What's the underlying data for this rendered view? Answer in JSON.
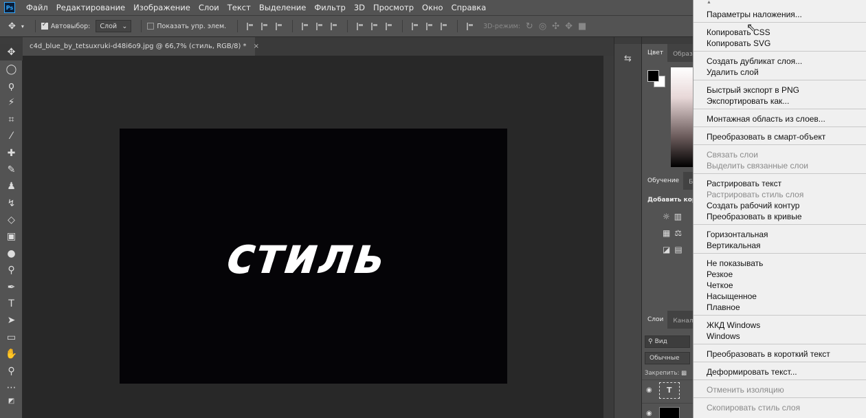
{
  "menubar": {
    "logo": "Ps",
    "items": [
      "Файл",
      "Редактирование",
      "Изображение",
      "Слои",
      "Текст",
      "Выделение",
      "Фильтр",
      "3D",
      "Просмотр",
      "Окно",
      "Справка"
    ]
  },
  "options": {
    "autoselect_label": "Автовыбор:",
    "autoselect_checked": true,
    "autoselect_value": "Слой",
    "show_controls_label": "Показать упр. элем.",
    "show_controls_checked": false,
    "mode_3d_label": "3D-режим:"
  },
  "document": {
    "tab_title": "c4d_blue_by_tetsuxruki-d48i6o9.jpg @ 66,7% (стиль, RGB/8) *",
    "close_glyph": "×",
    "image_text": "стиль"
  },
  "panels": {
    "color_tabs": [
      "Цвет",
      "Образ"
    ],
    "learn_tabs": [
      "Обучение",
      "Б"
    ],
    "add_label": "Добавить кор",
    "layers_tabs": [
      "Слои",
      "Канал"
    ],
    "search_label": "Вид",
    "blend_mode": "Обычные",
    "lock_label": "Закрепить:",
    "text_layer_glyph": "T"
  },
  "context_menu": {
    "groups": [
      [
        {
          "label": "Параметры наложения...",
          "enabled": true
        }
      ],
      [
        {
          "label": "Копировать CSS",
          "enabled": true
        },
        {
          "label": "Копировать SVG",
          "enabled": true
        }
      ],
      [
        {
          "label": "Создать дубликат слоя...",
          "enabled": true
        },
        {
          "label": "Удалить слой",
          "enabled": true
        }
      ],
      [
        {
          "label": "Быстрый экспорт в PNG",
          "enabled": true
        },
        {
          "label": "Экспортировать как...",
          "enabled": true
        }
      ],
      [
        {
          "label": "Монтажная область из слоев...",
          "enabled": true
        }
      ],
      [
        {
          "label": "Преобразовать в смарт-объект",
          "enabled": true
        }
      ],
      [
        {
          "label": "Связать слои",
          "enabled": false
        },
        {
          "label": "Выделить связанные слои",
          "enabled": false
        }
      ],
      [
        {
          "label": "Растрировать текст",
          "enabled": true
        },
        {
          "label": "Растрировать стиль слоя",
          "enabled": false
        },
        {
          "label": "Создать рабочий контур",
          "enabled": true
        },
        {
          "label": "Преобразовать в кривые",
          "enabled": true
        }
      ],
      [
        {
          "label": "Горизонтальная",
          "enabled": true
        },
        {
          "label": "Вертикальная",
          "enabled": true
        }
      ],
      [
        {
          "label": "Не показывать",
          "enabled": true
        },
        {
          "label": "Резкое",
          "enabled": true
        },
        {
          "label": "Четкое",
          "enabled": true
        },
        {
          "label": "Насыщенное",
          "enabled": true
        },
        {
          "label": "Плавное",
          "enabled": true
        }
      ],
      [
        {
          "label": "ЖКД Windows",
          "enabled": true
        },
        {
          "label": "Windows",
          "enabled": true
        }
      ],
      [
        {
          "label": "Преобразовать в короткий текст",
          "enabled": true
        }
      ],
      [
        {
          "label": "Деформировать текст...",
          "enabled": true
        }
      ],
      [
        {
          "label": "Отменить изоляцию",
          "enabled": false
        }
      ],
      [
        {
          "label": "Скопировать стиль слоя",
          "enabled": false
        }
      ]
    ]
  }
}
